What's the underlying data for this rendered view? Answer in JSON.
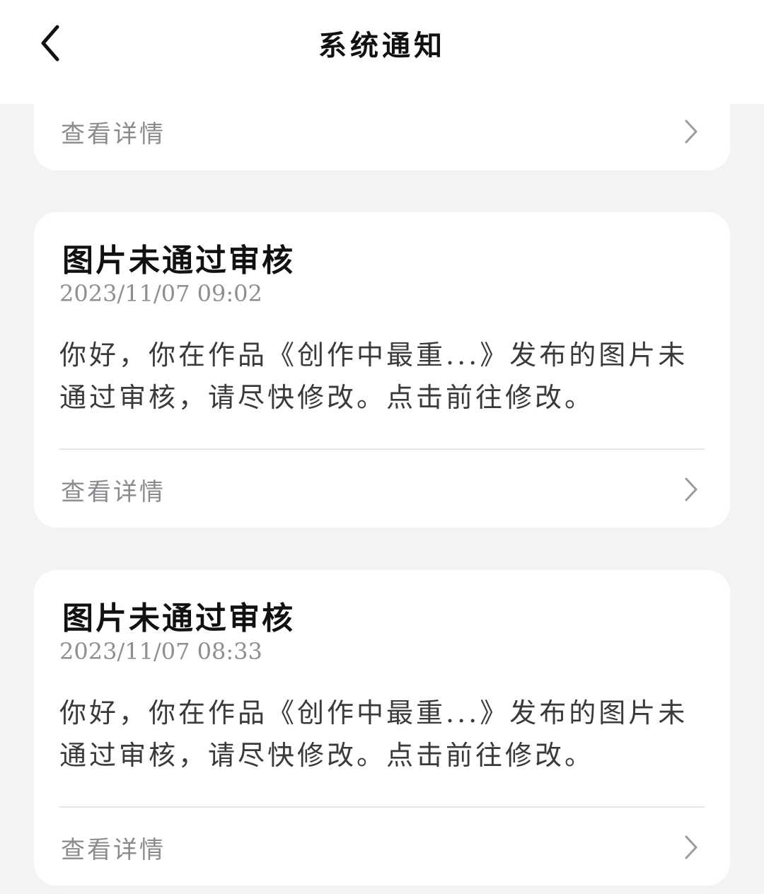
{
  "header": {
    "title": "系统通知",
    "back_icon": "chevron-left-icon"
  },
  "notifications": [
    {
      "partial": true,
      "detail_label": "查看详情"
    },
    {
      "title": "图片未通过审核",
      "time": "2023/11/07 09:02",
      "body": "你好，你在作品《创作中最重...》发布的图片未通过审核，请尽快修改。点击前往修改。",
      "detail_label": "查看详情"
    },
    {
      "title": "图片未通过审核",
      "time": "2023/11/07 08:33",
      "body": "你好，你在作品《创作中最重...》发布的图片未通过审核，请尽快修改。点击前往修改。",
      "detail_label": "查看详情"
    }
  ],
  "colors": {
    "background": "#f2f3f5",
    "card": "#ffffff",
    "secondary_text": "#8e8e93"
  }
}
